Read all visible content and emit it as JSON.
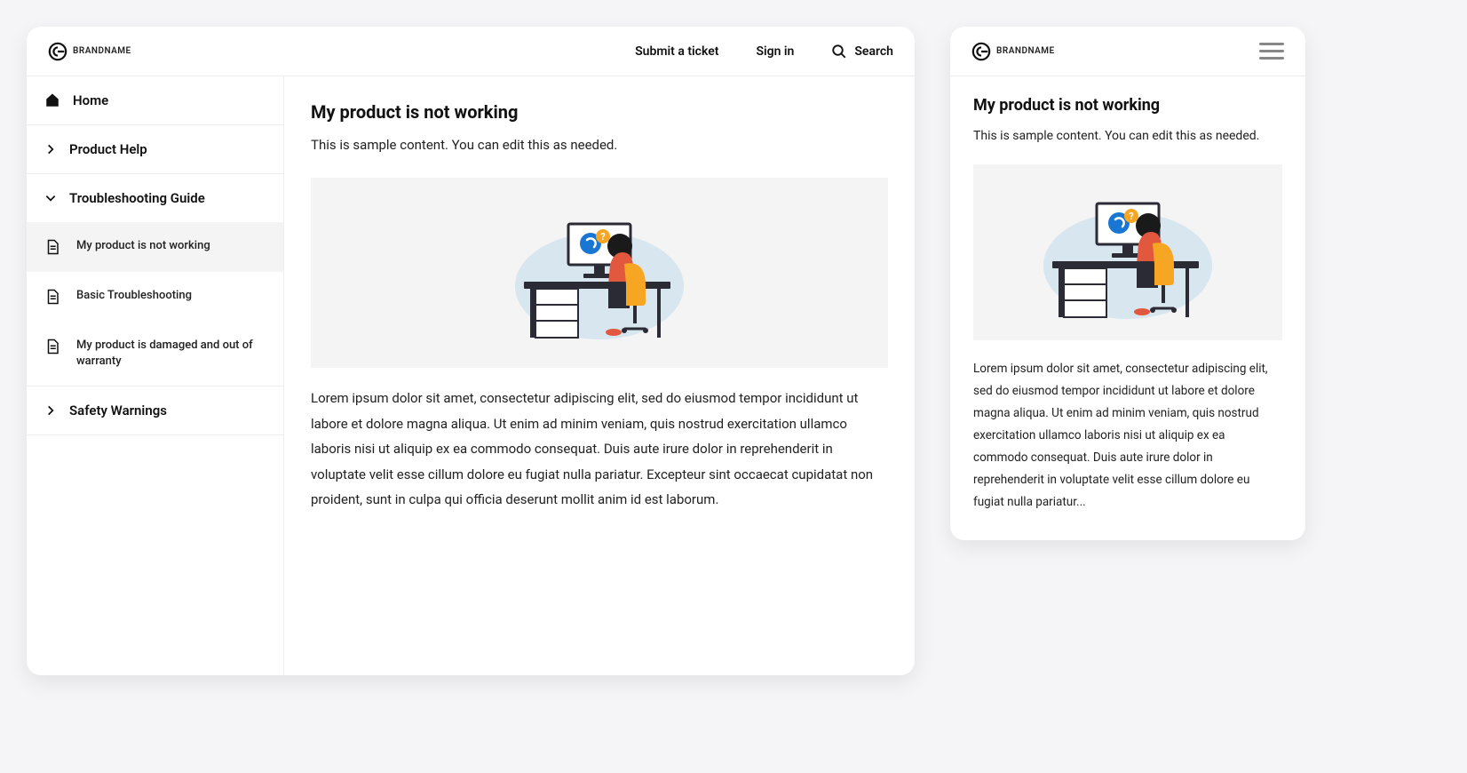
{
  "brand": {
    "name": "BRANDNAME"
  },
  "header": {
    "submit_label": "Submit a ticket",
    "signin_label": "Sign in",
    "search_label": "Search"
  },
  "sidebar": {
    "home": "Home",
    "product_help": "Product Help",
    "troubleshooting": "Troubleshooting Guide",
    "safety": "Safety Warnings",
    "sub": {
      "not_working": "My product is not working",
      "basic": "Basic Troubleshooting",
      "damaged": "My product is damaged and out of warranty"
    }
  },
  "article": {
    "title": "My product is not working",
    "intro": "This is sample content. You can edit this as needed.",
    "body_desktop": "Lorem ipsum dolor sit amet, consectetur adipiscing elit, sed do eiusmod tempor incididunt ut labore et dolore magna aliqua. Ut enim ad minim veniam, quis nostrud exercitation ullamco laboris nisi ut aliquip ex ea commodo consequat. Duis aute irure dolor in reprehenderit in voluptate velit esse cillum dolore eu fugiat nulla pariatur. Excepteur sint occaecat cupidatat non proident, sunt in culpa qui officia deserunt mollit anim id est laborum.",
    "body_mobile": "Lorem ipsum dolor sit amet, consectetur adipiscing elit, sed do eiusmod tempor incididunt ut labore et dolore magna aliqua. Ut enim ad minim veniam, quis nostrud exercitation ullamco laboris nisi ut aliquip ex ea commodo consequat. Duis aute irure dolor in reprehenderit in voluptate velit esse cillum dolore eu fugiat nulla pariatur..."
  }
}
